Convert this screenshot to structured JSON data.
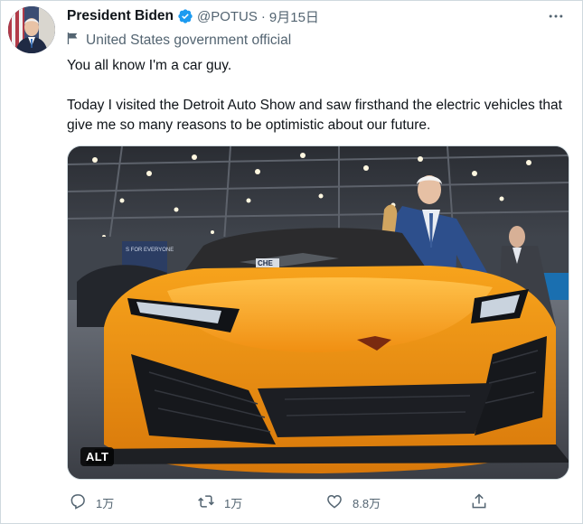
{
  "author": {
    "name": "President Biden",
    "handle": "@POTUS",
    "separator": "·",
    "date": "9月15日",
    "label": "United States government official"
  },
  "tweet": {
    "line1": "You all know I'm a car guy.",
    "line2": "Today I visited the Detroit Auto Show and saw firsthand the electric vehicles that give me so many reasons to be optimistic about our future."
  },
  "media": {
    "alt_badge": "ALT",
    "backdrop_sign": "S FOR EVERYONE",
    "plate_text": "CHE"
  },
  "actions": {
    "reply_count": "1万",
    "retweet_count": "1万",
    "like_count": "8.8万"
  },
  "colors": {
    "verified": "#1d9bf0",
    "secondary_text": "#536471",
    "car_body": "#f5a11b"
  },
  "icons": [
    "verified-badge-icon",
    "more-icon",
    "government-flag-icon",
    "reply-icon",
    "retweet-icon",
    "like-icon",
    "share-icon"
  ]
}
